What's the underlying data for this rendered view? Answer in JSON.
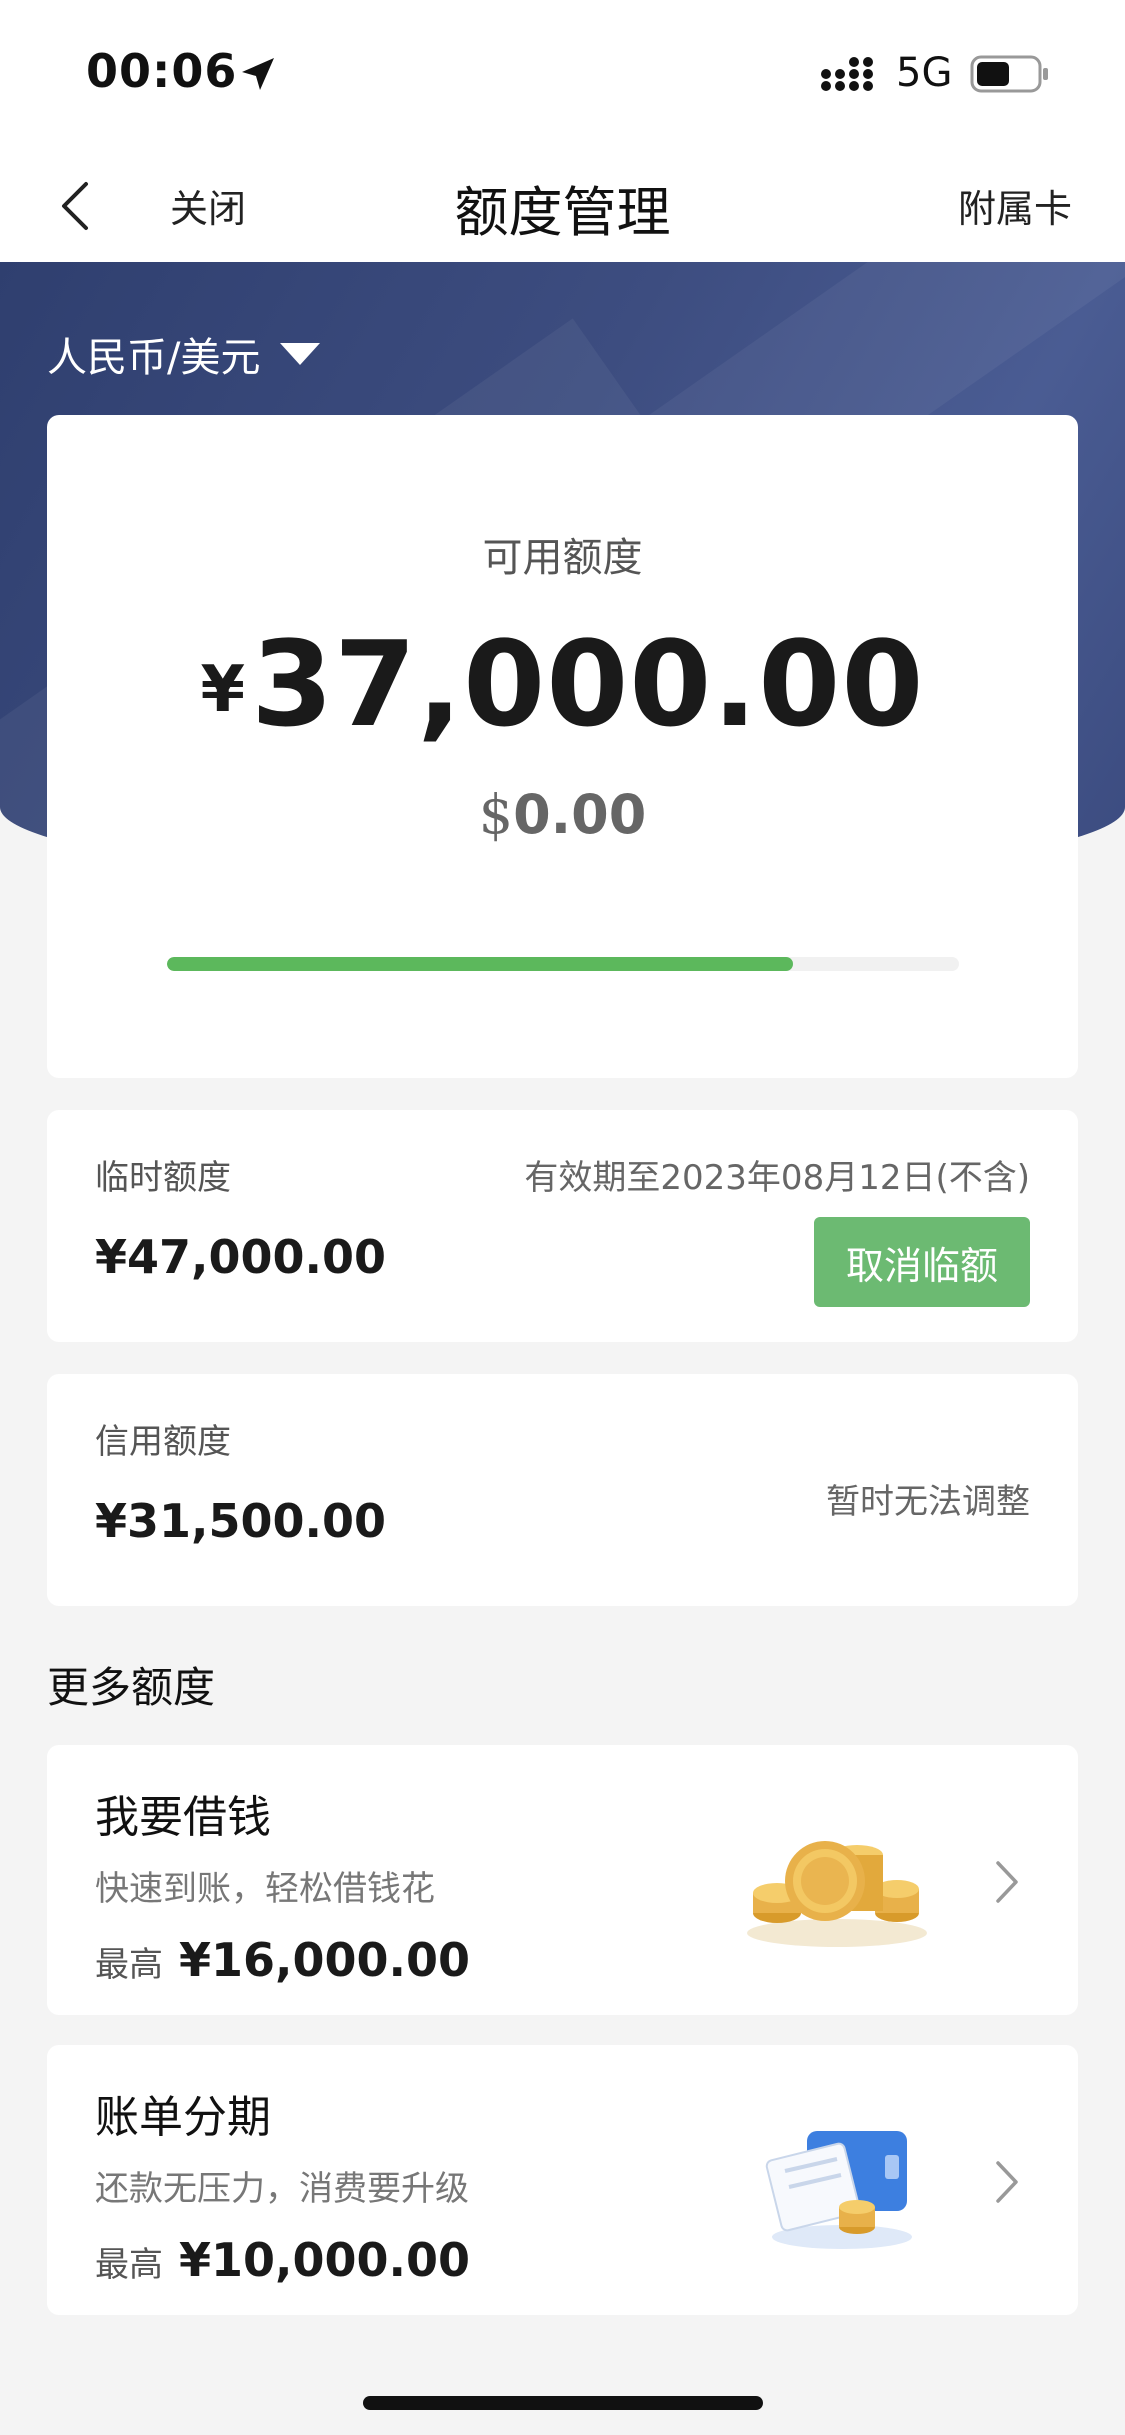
{
  "status_bar": {
    "time": "00:06",
    "network": "5G",
    "battery_level": 0.55
  },
  "nav": {
    "close_label": "关闭",
    "title": "额度管理",
    "right_label": "附属卡"
  },
  "currency": {
    "label": "人民币/美元"
  },
  "available": {
    "label": "可用额度",
    "cny_symbol": "¥",
    "cny_amount": "37,000.00",
    "usd_symbol": "$",
    "usd_amount": "0.00",
    "usage_fraction": 0.79,
    "progress_color": "#5cb85c"
  },
  "temporary": {
    "label": "临时额度",
    "amount": "¥47,000.00",
    "validity": "有效期至2023年08月12日(不含)",
    "cancel_label": "取消临额",
    "button_color": "#6cba72"
  },
  "credit": {
    "label": "信用额度",
    "amount": "¥31,500.00",
    "status": "暂时无法调整"
  },
  "more": {
    "title": "更多额度",
    "items": [
      {
        "title": "我要借钱",
        "desc": "快速到账，轻松借钱花",
        "max_label": "最高",
        "max_value": "¥16,000.00",
        "icon": "coins-icon"
      },
      {
        "title": "账单分期",
        "desc": "还款无压力，消费要升级",
        "max_label": "最高",
        "max_value": "¥10,000.00",
        "icon": "bill-card-icon"
      }
    ]
  },
  "colors": {
    "hero": "#3d4d80",
    "accent_green": "#5cb85c"
  }
}
